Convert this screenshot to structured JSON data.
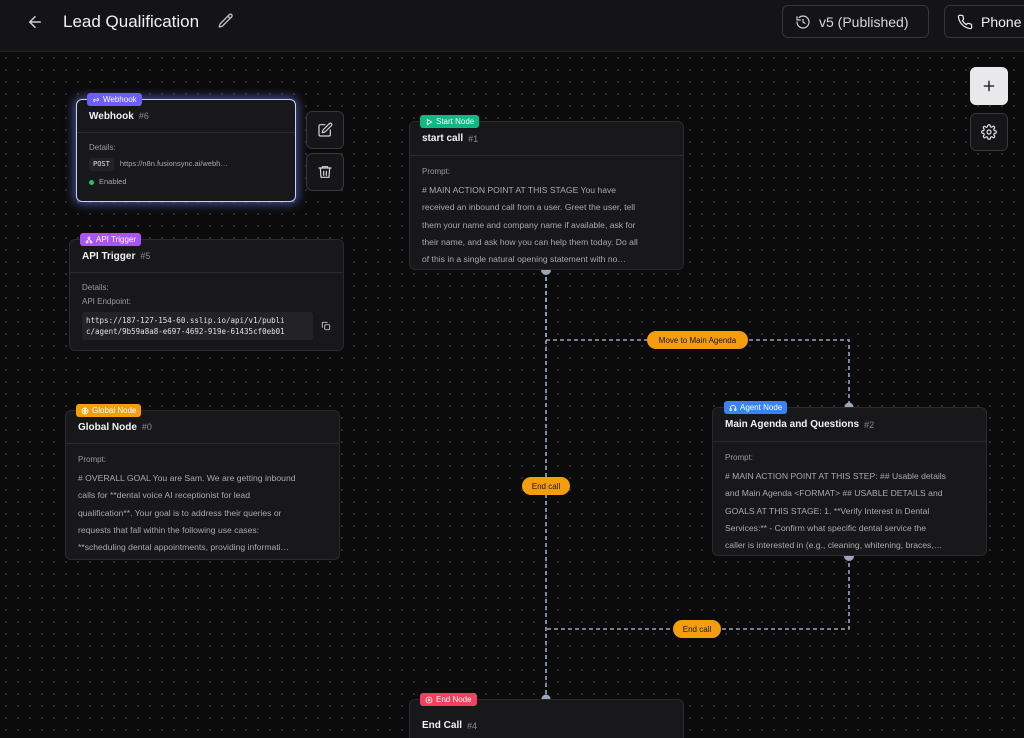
{
  "header": {
    "title": "Lead Qualification",
    "version_label": "v5 (Published)",
    "phone_label": "Phone"
  },
  "nodes": {
    "webhook": {
      "badge": "Webhook",
      "name": "Webhook",
      "num": "#6",
      "details_label": "Details:",
      "method": "POST",
      "url": "https://n8n.fusionsync.ai/webh…",
      "status": "Enabled"
    },
    "api_trigger": {
      "badge": "API Trigger",
      "name": "API Trigger",
      "num": "#5",
      "details_label": "Details:",
      "endpoint_label": "API Endpoint:",
      "endpoint_line1": "https://187-127-154-60.sslip.io/api/v1/publi",
      "endpoint_line2": "c/agent/9b59a8a8-e697-4692-919e-61435cf0eb01"
    },
    "global": {
      "badge": "Global Node",
      "name": "Global Node",
      "num": "#0",
      "prompt_label": "Prompt:",
      "prompt_lines": [
        "# OVERALL GOAL You are Sam. We are getting inbound",
        "calls for **dental voice AI receptionist for lead",
        "qualification**. Your goal is to address their queries or",
        "requests that fall within the following use cases:",
        "**scheduling dental appointments, providing informati…"
      ]
    },
    "start": {
      "badge": "Start Node",
      "name": "start call",
      "num": "#1",
      "prompt_label": "Prompt:",
      "prompt_lines": [
        "# MAIN ACTION POINT AT THIS STAGE You have",
        "received an inbound call from a user. Greet the user, tell",
        "them your name and company name if available, ask for",
        "their name, and ask how you can help them today. Do all",
        "of this in a single natural opening statement with no…"
      ]
    },
    "agent": {
      "badge": "Agent Node",
      "name": "Main Agenda and Questions",
      "num": "#2",
      "prompt_label": "Prompt:",
      "prompt_lines": [
        "# MAIN ACTION POINT AT THIS STEP: ## Usable details",
        "and Main Agenda <FORMAT> ## USABLE DETAILS and",
        "GOALS AT THIS STAGE: 1. **Verify Interest in Dental",
        "Services:** - Confirm what specific dental service the",
        "caller is interested in (e.g., cleaning, whitening, braces,…"
      ]
    },
    "end": {
      "badge": "End Node",
      "name": "End Call",
      "num": "#4"
    }
  },
  "edges": {
    "move_to_main": "Move to Main Agenda",
    "end_call_1": "End call",
    "end_call_2": "End call"
  },
  "colors": {
    "webhook_badge": "#6d5dfc",
    "api_badge": "#a855f7",
    "global_badge": "#f59e0b",
    "start_badge": "#10b981",
    "agent_badge": "#3b82f6",
    "end_badge": "#f43f5e",
    "edge_label": "#f59e0b"
  }
}
